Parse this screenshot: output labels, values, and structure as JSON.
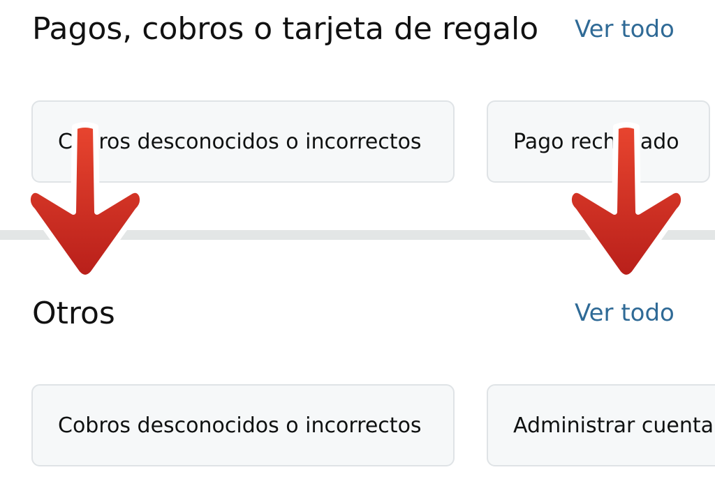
{
  "sections": [
    {
      "title": "Pagos, cobros o tarjeta de regalo",
      "see_all": "Ver todo",
      "cards": [
        "Cobros desconocidos o incorrectos",
        "Pago rechazado"
      ]
    },
    {
      "title": "Otros",
      "see_all": "Ver todo",
      "cards": [
        "Cobros desconocidos o incorrectos",
        "Administrar cuenta"
      ]
    }
  ],
  "colors": {
    "link": "#2f6a96",
    "card_bg": "#f6f8f9",
    "card_border": "#dfe3e6",
    "divider": "#e3e6e6",
    "arrow_red": "#d52b22"
  },
  "icons": [
    "arrow-down-icon",
    "arrow-down-icon"
  ]
}
